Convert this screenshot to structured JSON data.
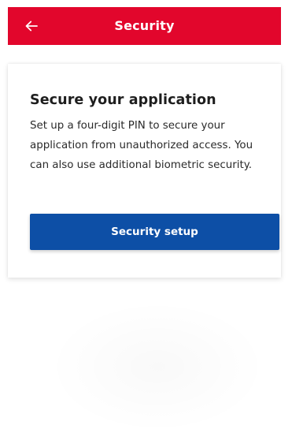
{
  "app_bar": {
    "title": "Security",
    "back_icon": "arrow-left-icon",
    "color": "#e2062c"
  },
  "card": {
    "title": "Secure your application",
    "body": "Set up a four-digit PIN to secure your application from unauthorized access. You can also use additional biometric security.",
    "button_label": "Security setup",
    "button_color": "#0d4fa6"
  }
}
